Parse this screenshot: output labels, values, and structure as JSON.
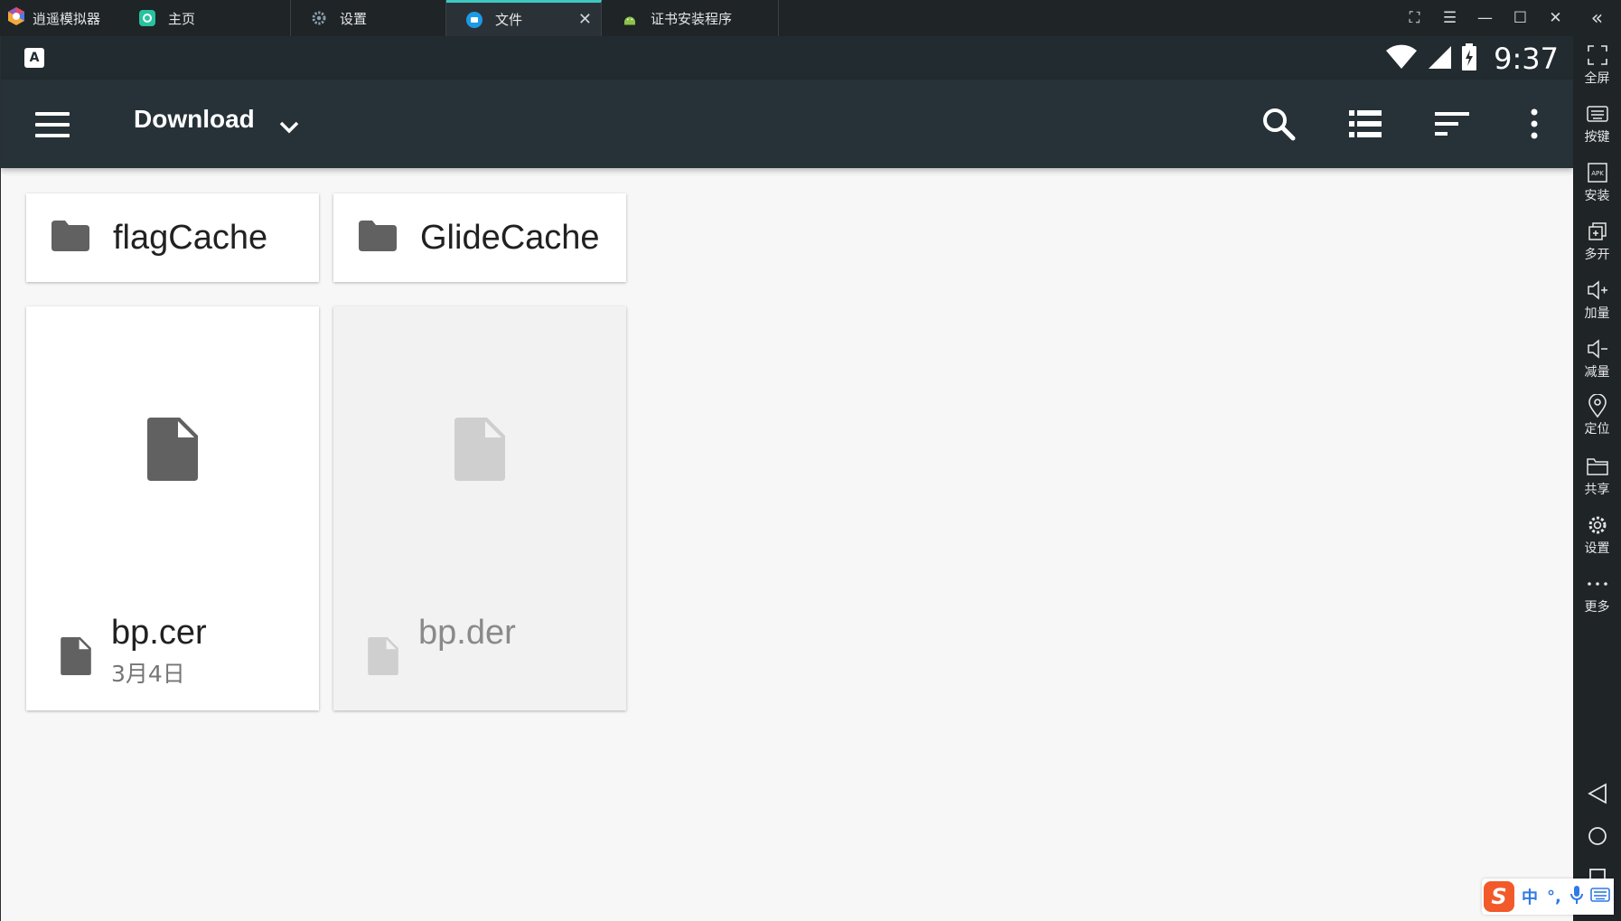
{
  "emulator": {
    "app_name": "逍遥模拟器",
    "tabs": [
      {
        "label": "主页",
        "icon": "home-icon",
        "color": "#27c2a0"
      },
      {
        "label": "设置",
        "icon": "gear-icon",
        "color": "#8aa0ad"
      },
      {
        "label": "文件",
        "icon": "files-icon",
        "color": "#1a9be6",
        "active": true
      },
      {
        "label": "证书安装程序",
        "icon": "android-icon",
        "color": "#8bc34a"
      }
    ],
    "window_controls": [
      "screenshot-icon",
      "menu-icon",
      "minimize-icon",
      "maximize-icon",
      "close-icon"
    ],
    "collapse": "«"
  },
  "status_bar": {
    "notification_icon": "A",
    "time": "9:37"
  },
  "toolbar": {
    "title": "Download",
    "actions": [
      "search-icon",
      "list-view-icon",
      "sort-icon",
      "more-vert-icon"
    ]
  },
  "folders": [
    {
      "name": "flagCache"
    },
    {
      "name": "GlideCache"
    }
  ],
  "files": [
    {
      "name": "bp.cer",
      "date": "3月4日",
      "dimmed": false
    },
    {
      "name": "bp.der",
      "date": "",
      "dimmed": true
    }
  ],
  "sidebar": {
    "buttons": [
      {
        "label": "全屏",
        "icon": "fullscreen-icon"
      },
      {
        "label": "按键",
        "icon": "keyboard-icon"
      },
      {
        "label": "安装",
        "icon": "apk-icon"
      },
      {
        "label": "多开",
        "icon": "multi-instance-icon"
      },
      {
        "label": "加量",
        "icon": "volume-up-icon"
      },
      {
        "label": "减量",
        "icon": "volume-down-icon"
      },
      {
        "label": "定位",
        "icon": "location-icon"
      },
      {
        "label": "共享",
        "icon": "folder-share-icon"
      },
      {
        "label": "设置",
        "icon": "settings-icon"
      },
      {
        "label": "更多",
        "icon": "more-horiz-icon"
      }
    ],
    "nav": [
      "back-icon",
      "home-circle-icon",
      "recents-icon"
    ]
  },
  "ime": {
    "logo": "S",
    "mode": "中",
    "punct": "°,"
  },
  "colors": {
    "toolbar": "#263238",
    "status_bar": "#212b30",
    "accent_tab": "#3ec7c1",
    "content_bg": "#f7f7f7"
  }
}
